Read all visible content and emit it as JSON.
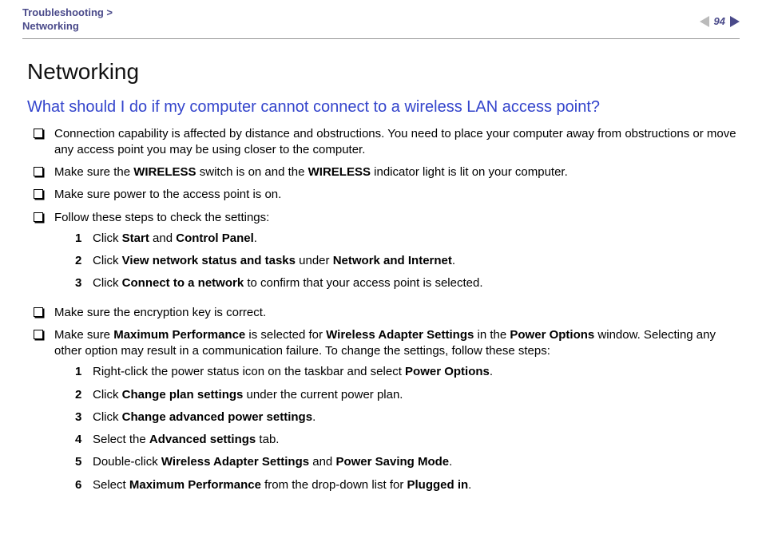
{
  "header": {
    "breadcrumb_top": "Troubleshooting >",
    "breadcrumb_bottom": "Networking",
    "page_number": "94"
  },
  "title": "Networking",
  "question": "What should I do if my computer cannot connect to a wireless LAN access point?",
  "bullets": [
    {
      "parts": [
        {
          "t": "Connection capability is affected by distance and obstructions. You need to place your computer away from obstructions or move any access point you may be using closer to the computer."
        }
      ]
    },
    {
      "parts": [
        {
          "t": "Make sure the "
        },
        {
          "b": true,
          "t": "WIRELESS"
        },
        {
          "t": " switch is on and the "
        },
        {
          "b": true,
          "t": "WIRELESS"
        },
        {
          "t": " indicator light is lit on your computer."
        }
      ]
    },
    {
      "parts": [
        {
          "t": "Make sure power to the access point is on."
        }
      ]
    },
    {
      "parts": [
        {
          "t": "Follow these steps to check the settings:"
        }
      ],
      "steps": [
        [
          {
            "t": "Click "
          },
          {
            "b": true,
            "t": "Start"
          },
          {
            "t": " and "
          },
          {
            "b": true,
            "t": "Control Panel"
          },
          {
            "t": "."
          }
        ],
        [
          {
            "t": "Click "
          },
          {
            "b": true,
            "t": "View network status and tasks"
          },
          {
            "t": " under "
          },
          {
            "b": true,
            "t": "Network and Internet"
          },
          {
            "t": "."
          }
        ],
        [
          {
            "t": "Click "
          },
          {
            "b": true,
            "t": "Connect to a network"
          },
          {
            "t": " to confirm that your access point is selected."
          }
        ]
      ]
    },
    {
      "parts": [
        {
          "t": "Make sure the encryption key is correct."
        }
      ]
    },
    {
      "parts": [
        {
          "t": "Make sure "
        },
        {
          "b": true,
          "t": "Maximum Performance"
        },
        {
          "t": " is selected for "
        },
        {
          "b": true,
          "t": "Wireless Adapter Settings"
        },
        {
          "t": " in the "
        },
        {
          "b": true,
          "t": "Power Options"
        },
        {
          "t": " window. Selecting any other option may result in a communication failure. To change the settings, follow these steps:"
        }
      ],
      "steps": [
        [
          {
            "t": "Right-click the power status icon on the taskbar and select "
          },
          {
            "b": true,
            "t": "Power Options"
          },
          {
            "t": "."
          }
        ],
        [
          {
            "t": "Click "
          },
          {
            "b": true,
            "t": "Change plan settings"
          },
          {
            "t": " under the current power plan."
          }
        ],
        [
          {
            "t": "Click "
          },
          {
            "b": true,
            "t": "Change advanced power settings"
          },
          {
            "t": "."
          }
        ],
        [
          {
            "t": "Select the "
          },
          {
            "b": true,
            "t": "Advanced settings"
          },
          {
            "t": " tab."
          }
        ],
        [
          {
            "t": "Double-click "
          },
          {
            "b": true,
            "t": "Wireless Adapter Settings"
          },
          {
            "t": " and "
          },
          {
            "b": true,
            "t": "Power Saving Mode"
          },
          {
            "t": "."
          }
        ],
        [
          {
            "t": "Select "
          },
          {
            "b": true,
            "t": "Maximum Performance"
          },
          {
            "t": " from the drop-down list for "
          },
          {
            "b": true,
            "t": "Plugged in"
          },
          {
            "t": "."
          }
        ]
      ]
    }
  ]
}
